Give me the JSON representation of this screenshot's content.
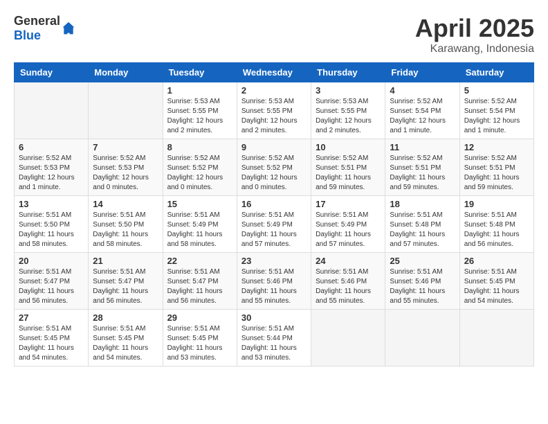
{
  "header": {
    "logo_general": "General",
    "logo_blue": "Blue",
    "month": "April 2025",
    "location": "Karawang, Indonesia"
  },
  "weekdays": [
    "Sunday",
    "Monday",
    "Tuesday",
    "Wednesday",
    "Thursday",
    "Friday",
    "Saturday"
  ],
  "weeks": [
    [
      {
        "day": "",
        "info": ""
      },
      {
        "day": "",
        "info": ""
      },
      {
        "day": "1",
        "info": "Sunrise: 5:53 AM\nSunset: 5:55 PM\nDaylight: 12 hours and 2 minutes."
      },
      {
        "day": "2",
        "info": "Sunrise: 5:53 AM\nSunset: 5:55 PM\nDaylight: 12 hours and 2 minutes."
      },
      {
        "day": "3",
        "info": "Sunrise: 5:53 AM\nSunset: 5:55 PM\nDaylight: 12 hours and 2 minutes."
      },
      {
        "day": "4",
        "info": "Sunrise: 5:52 AM\nSunset: 5:54 PM\nDaylight: 12 hours and 1 minute."
      },
      {
        "day": "5",
        "info": "Sunrise: 5:52 AM\nSunset: 5:54 PM\nDaylight: 12 hours and 1 minute."
      }
    ],
    [
      {
        "day": "6",
        "info": "Sunrise: 5:52 AM\nSunset: 5:53 PM\nDaylight: 12 hours and 1 minute."
      },
      {
        "day": "7",
        "info": "Sunrise: 5:52 AM\nSunset: 5:53 PM\nDaylight: 12 hours and 0 minutes."
      },
      {
        "day": "8",
        "info": "Sunrise: 5:52 AM\nSunset: 5:52 PM\nDaylight: 12 hours and 0 minutes."
      },
      {
        "day": "9",
        "info": "Sunrise: 5:52 AM\nSunset: 5:52 PM\nDaylight: 12 hours and 0 minutes."
      },
      {
        "day": "10",
        "info": "Sunrise: 5:52 AM\nSunset: 5:51 PM\nDaylight: 11 hours and 59 minutes."
      },
      {
        "day": "11",
        "info": "Sunrise: 5:52 AM\nSunset: 5:51 PM\nDaylight: 11 hours and 59 minutes."
      },
      {
        "day": "12",
        "info": "Sunrise: 5:52 AM\nSunset: 5:51 PM\nDaylight: 11 hours and 59 minutes."
      }
    ],
    [
      {
        "day": "13",
        "info": "Sunrise: 5:51 AM\nSunset: 5:50 PM\nDaylight: 11 hours and 58 minutes."
      },
      {
        "day": "14",
        "info": "Sunrise: 5:51 AM\nSunset: 5:50 PM\nDaylight: 11 hours and 58 minutes."
      },
      {
        "day": "15",
        "info": "Sunrise: 5:51 AM\nSunset: 5:49 PM\nDaylight: 11 hours and 58 minutes."
      },
      {
        "day": "16",
        "info": "Sunrise: 5:51 AM\nSunset: 5:49 PM\nDaylight: 11 hours and 57 minutes."
      },
      {
        "day": "17",
        "info": "Sunrise: 5:51 AM\nSunset: 5:49 PM\nDaylight: 11 hours and 57 minutes."
      },
      {
        "day": "18",
        "info": "Sunrise: 5:51 AM\nSunset: 5:48 PM\nDaylight: 11 hours and 57 minutes."
      },
      {
        "day": "19",
        "info": "Sunrise: 5:51 AM\nSunset: 5:48 PM\nDaylight: 11 hours and 56 minutes."
      }
    ],
    [
      {
        "day": "20",
        "info": "Sunrise: 5:51 AM\nSunset: 5:47 PM\nDaylight: 11 hours and 56 minutes."
      },
      {
        "day": "21",
        "info": "Sunrise: 5:51 AM\nSunset: 5:47 PM\nDaylight: 11 hours and 56 minutes."
      },
      {
        "day": "22",
        "info": "Sunrise: 5:51 AM\nSunset: 5:47 PM\nDaylight: 11 hours and 56 minutes."
      },
      {
        "day": "23",
        "info": "Sunrise: 5:51 AM\nSunset: 5:46 PM\nDaylight: 11 hours and 55 minutes."
      },
      {
        "day": "24",
        "info": "Sunrise: 5:51 AM\nSunset: 5:46 PM\nDaylight: 11 hours and 55 minutes."
      },
      {
        "day": "25",
        "info": "Sunrise: 5:51 AM\nSunset: 5:46 PM\nDaylight: 11 hours and 55 minutes."
      },
      {
        "day": "26",
        "info": "Sunrise: 5:51 AM\nSunset: 5:45 PM\nDaylight: 11 hours and 54 minutes."
      }
    ],
    [
      {
        "day": "27",
        "info": "Sunrise: 5:51 AM\nSunset: 5:45 PM\nDaylight: 11 hours and 54 minutes."
      },
      {
        "day": "28",
        "info": "Sunrise: 5:51 AM\nSunset: 5:45 PM\nDaylight: 11 hours and 54 minutes."
      },
      {
        "day": "29",
        "info": "Sunrise: 5:51 AM\nSunset: 5:45 PM\nDaylight: 11 hours and 53 minutes."
      },
      {
        "day": "30",
        "info": "Sunrise: 5:51 AM\nSunset: 5:44 PM\nDaylight: 11 hours and 53 minutes."
      },
      {
        "day": "",
        "info": ""
      },
      {
        "day": "",
        "info": ""
      },
      {
        "day": "",
        "info": ""
      }
    ]
  ]
}
